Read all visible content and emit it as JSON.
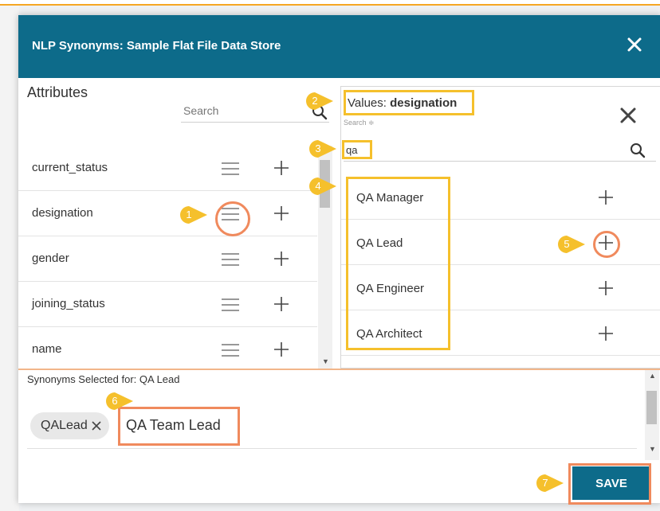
{
  "dialog": {
    "title": "NLP Synonyms: Sample Flat File Data Store"
  },
  "attributes": {
    "title": "Attributes",
    "search_placeholder": "Search",
    "items": [
      {
        "label": "current_status"
      },
      {
        "label": "designation"
      },
      {
        "label": "gender"
      },
      {
        "label": "joining_status"
      },
      {
        "label": "name"
      }
    ]
  },
  "values": {
    "title_prefix": "Values:",
    "title_attribute": "designation",
    "search_label": "Search",
    "search_value": "qa",
    "items": [
      {
        "label": "QA Manager"
      },
      {
        "label": "QA Lead"
      },
      {
        "label": "QA Engineer"
      },
      {
        "label": "QA Architect"
      }
    ]
  },
  "synonyms": {
    "title": "Synonyms Selected for: QA Lead",
    "chips": [
      {
        "label": "QALead"
      }
    ],
    "input_value": "QA Team Lead"
  },
  "actions": {
    "save_label": "SAVE"
  },
  "annotations": {
    "markers": [
      "1",
      "2",
      "3",
      "4",
      "5",
      "6",
      "7"
    ]
  },
  "colors": {
    "header": "#0d6b8a",
    "save_button": "#0d6b8a",
    "marker": "#f5c02c",
    "highlight_box": "#f5c02c",
    "highlight_orange": "#f08a5d"
  },
  "icons": {
    "close": "close-icon",
    "menu": "hamburger-menu-icon",
    "add": "plus-icon",
    "search": "search-icon",
    "remove_chip": "remove-chip-icon"
  }
}
